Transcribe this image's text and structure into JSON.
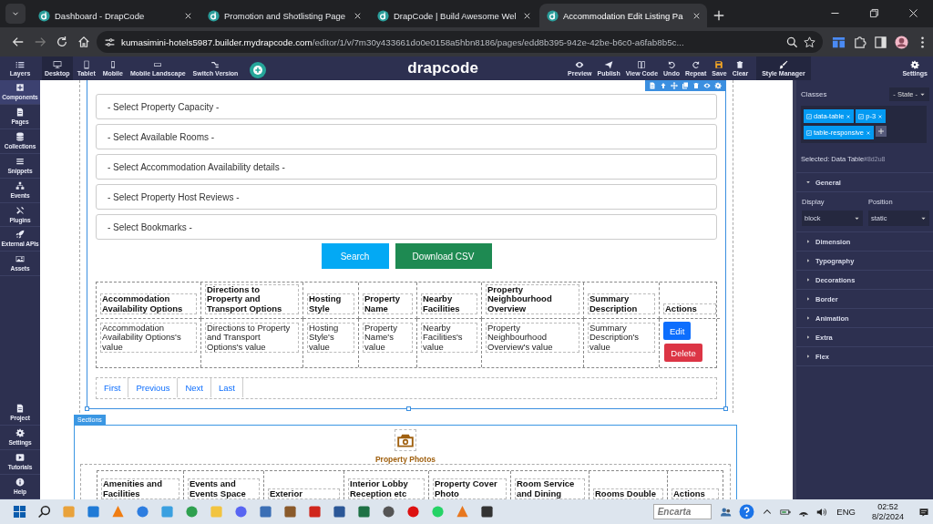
{
  "browser": {
    "tabs": [
      {
        "title": "Dashboard - DrapCode",
        "selected": false
      },
      {
        "title": "Promotion and Shotlisting Page",
        "selected": false
      },
      {
        "title": "DrapCode | Build Awesome Wel",
        "selected": false
      },
      {
        "title": "Accommodation Edit Listing Pa",
        "selected": true
      }
    ],
    "address": {
      "host": "kumasimini-hotels5987.builder.mydrapcode.com",
      "path": "/editor/1/v/7m30y433661do0e0158a5hbn8186/pages/edd8b395-942e-42be-b6c0-a6fab8b5c..."
    }
  },
  "toolbar": {
    "layers": "Layers",
    "devices": [
      {
        "label": "Desktop",
        "selected": true
      },
      {
        "label": "Tablet",
        "selected": false
      },
      {
        "label": "Mobile",
        "selected": false
      },
      {
        "label": "Mobile Landscape",
        "selected": false
      },
      {
        "label": "Switch Version",
        "selected": false
      }
    ],
    "logo": "drapcode",
    "actions": [
      "Preview",
      "Publish",
      "View Code",
      "Undo",
      "Repeat",
      "Save",
      "Clear"
    ],
    "panels": [
      {
        "label": "Style Manager",
        "selected": true
      },
      {
        "label": "Settings",
        "selected": false
      }
    ]
  },
  "sidebar": {
    "items": [
      {
        "label": "Components",
        "selected": true
      },
      {
        "label": "Pages",
        "selected": false
      },
      {
        "label": "Collections",
        "selected": false
      },
      {
        "label": "Snippets",
        "selected": false
      },
      {
        "label": "Events",
        "selected": false
      },
      {
        "label": "Plugins",
        "selected": false
      },
      {
        "label": "External APIs",
        "selected": false
      },
      {
        "label": "Assets",
        "selected": false
      }
    ],
    "bottom_items": [
      "Project",
      "Settings",
      "Tutorials",
      "Help"
    ]
  },
  "canvas": {
    "selects": [
      "- Select Property Capacity -",
      "- Select Available Rooms -",
      "- Select Accommodation Availability details -",
      "- Select Property Host Reviews -",
      "- Select Bookmarks -"
    ],
    "buttons": [
      "Search",
      "Download CSV"
    ],
    "table": {
      "columns": [
        "Accommodation Availability Options",
        "Directions to Property and Transport Options",
        "Hosting Style",
        "Property Name",
        "Nearby Facilities",
        "Property Neighbourhood Overview",
        "Summary Description",
        "Actions"
      ],
      "rows": [
        [
          "Accommodation Availability Options's value",
          "Directions to Property and Transport Options's value",
          "Hosting Style's value",
          "Property Name's value",
          "Nearby Facilities's value",
          "Property Neighbourhood Overview's value",
          "Summary Description's value"
        ]
      ],
      "row_actions": [
        "Edit",
        "Delete"
      ]
    },
    "pagination": [
      "First",
      "Previous",
      "Next",
      "Last"
    ],
    "section_tag": "Sections",
    "photos_title": "Property Photos",
    "photos_table": {
      "columns": [
        "Amenities and Facilities",
        "Events and Events Space",
        "Exterior",
        "Interior Lobby Reception etc",
        "Property Cover Photo",
        "Room Service and Dining",
        "Rooms Double",
        "Actions"
      ]
    }
  },
  "style_manager": {
    "classes_label": "Classes",
    "state": "- State -",
    "classes": [
      "data-table",
      "p-3",
      "table-responsive"
    ],
    "selected_label": "Selected:",
    "selected_name": "Data Table",
    "selected_id": "#8d2u8",
    "sections": [
      {
        "title": "General",
        "expanded": true
      },
      {
        "title": "Dimension",
        "expanded": false
      },
      {
        "title": "Typography",
        "expanded": false
      },
      {
        "title": "Decorations",
        "expanded": false
      },
      {
        "title": "Border",
        "expanded": false
      },
      {
        "title": "Animation",
        "expanded": false
      },
      {
        "title": "Extra",
        "expanded": false
      },
      {
        "title": "Flex",
        "expanded": false
      }
    ],
    "general_fields": [
      {
        "label": "Display",
        "value": "block"
      },
      {
        "label": "Position",
        "value": "static"
      }
    ]
  },
  "taskbar": {
    "encarta": "Encarta",
    "language": "ENG",
    "time": "02:52",
    "date": "8/2/2024"
  }
}
